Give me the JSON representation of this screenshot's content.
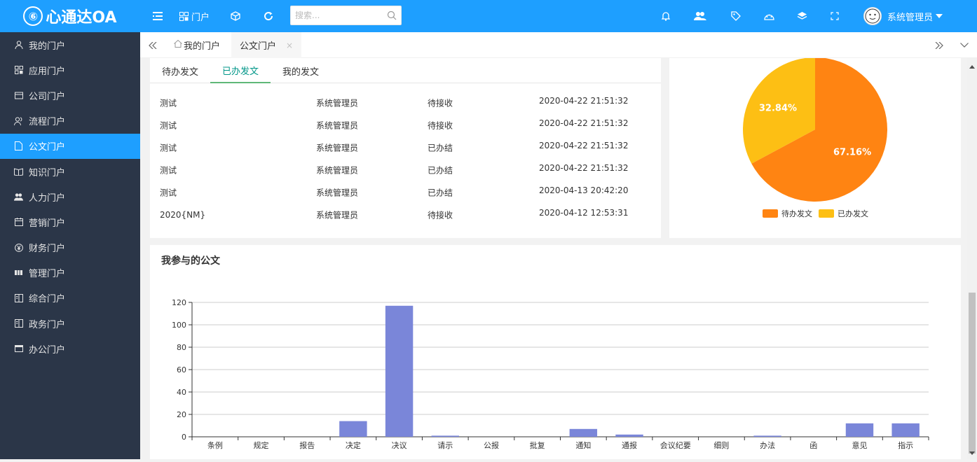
{
  "app": {
    "logo_glyph": "⑥",
    "logo_text": "心通达OA"
  },
  "topbar": {
    "portal_label": "门户",
    "search_placeholder": "搜索...",
    "user_name": "系统管理员"
  },
  "sidebar": {
    "items": [
      {
        "label": "我的门户",
        "icon": "user-icon"
      },
      {
        "label": "应用门户",
        "icon": "apps-icon"
      },
      {
        "label": "公司门户",
        "icon": "company-icon"
      },
      {
        "label": "流程门户",
        "icon": "flow-icon"
      },
      {
        "label": "公文门户",
        "icon": "document-icon",
        "active": true
      },
      {
        "label": "知识门户",
        "icon": "book-icon"
      },
      {
        "label": "人力门户",
        "icon": "people-icon"
      },
      {
        "label": "营销门户",
        "icon": "calendar-icon"
      },
      {
        "label": "财务门户",
        "icon": "yen-icon"
      },
      {
        "label": "管理门户",
        "icon": "grid-icon"
      },
      {
        "label": "综合门户",
        "icon": "book-open-icon"
      },
      {
        "label": "政务门户",
        "icon": "book-open-icon"
      },
      {
        "label": "办公门户",
        "icon": "window-icon"
      }
    ]
  },
  "tabs": [
    {
      "label": "我的门户"
    },
    {
      "label": "公文门户",
      "close": "×"
    }
  ],
  "doc_panel": {
    "subtabs": [
      "待办发文",
      "已办发文",
      "我的发文"
    ],
    "active_subtab": "已办发文",
    "rows": [
      {
        "title": "测试",
        "user": "系统管理员",
        "status": "待接收",
        "time": "2020-04-22 21:51:32"
      },
      {
        "title": "测试",
        "user": "系统管理员",
        "status": "待接收",
        "time": "2020-04-22 21:51:32"
      },
      {
        "title": "测试",
        "user": "系统管理员",
        "status": "已办结",
        "time": "2020-04-22 21:51:32"
      },
      {
        "title": "测试",
        "user": "系统管理员",
        "status": "已办结",
        "time": "2020-04-22 21:51:32"
      },
      {
        "title": "测试",
        "user": "系统管理员",
        "status": "已办结",
        "time": "2020-04-13 20:42:20"
      },
      {
        "title": "2020{NM}",
        "user": "系统管理员",
        "status": "待接收",
        "time": "2020-04-12 12:53:31"
      }
    ]
  },
  "chart_data": [
    {
      "type": "pie",
      "categories": [
        "待办发文",
        "已办发文"
      ],
      "values": [
        67.16,
        32.84
      ],
      "labels": [
        "67.16%",
        "32.84%"
      ],
      "colors": [
        "#ff8412",
        "#fdbf14"
      ],
      "legend": "bottom-center"
    },
    {
      "type": "bar",
      "title": "我参与的公文",
      "categories": [
        "条例",
        "规定",
        "报告",
        "决定",
        "决议",
        "请示",
        "公报",
        "批复",
        "通知",
        "通报",
        "会议纪要",
        "细则",
        "办法",
        "函",
        "意见",
        "指示"
      ],
      "values": [
        0,
        0,
        0,
        14,
        117,
        1,
        0,
        0,
        7,
        2,
        0,
        0,
        1,
        0,
        12,
        12
      ],
      "ylim": [
        0,
        120
      ],
      "yticks": [
        0,
        20,
        40,
        60,
        80,
        100,
        120
      ],
      "grid": true,
      "color": "#7a86d9"
    }
  ]
}
